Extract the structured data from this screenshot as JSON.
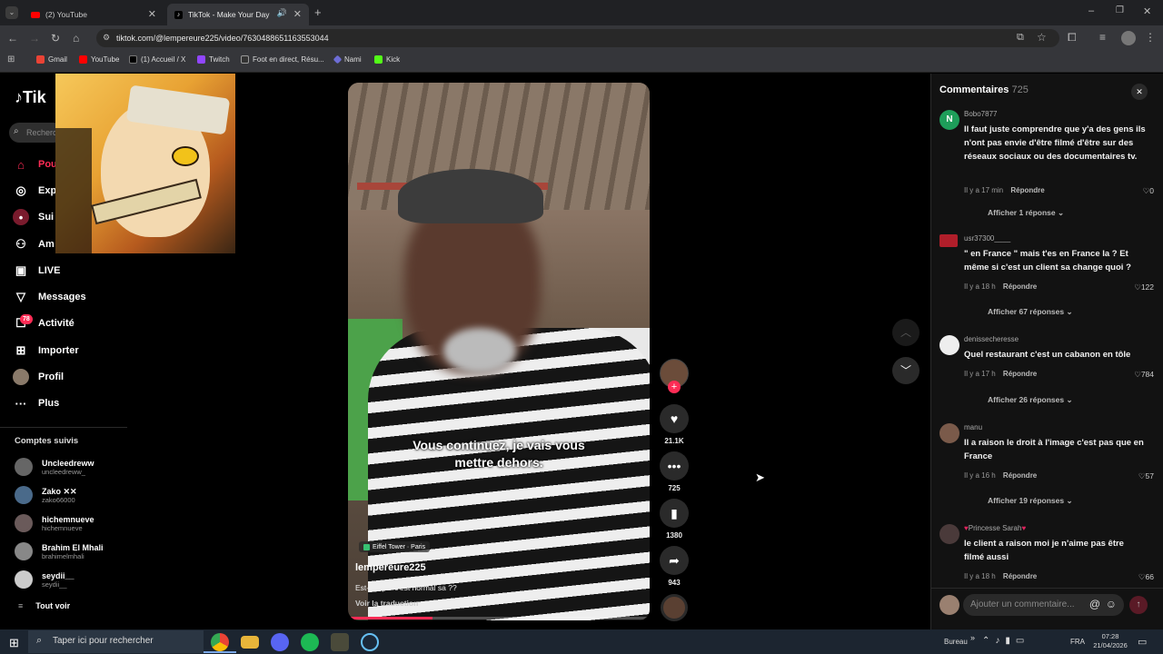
{
  "browser": {
    "tabs": [
      {
        "label": "(2) YouTube",
        "icon": "youtube-icon"
      },
      {
        "label": "TikTok - Make Your Day",
        "icon": "tiktok-icon"
      }
    ],
    "url": "tiktok.com/@lempereure225/video/7630488651163553044",
    "bookmarks": [
      "Gmail",
      "YouTube",
      "(1) Accueil / X",
      "Twitch",
      "Foot en direct, Résu...",
      "Nami",
      "Kick"
    ]
  },
  "sidebar": {
    "logo": "Tik",
    "search_placeholder": "Recherc",
    "items": [
      {
        "label": "Pou",
        "icon": "home-icon"
      },
      {
        "label": "Exp",
        "icon": "compass-icon"
      },
      {
        "label": "Sui",
        "icon": "following-icon"
      },
      {
        "label": "Am",
        "icon": "friends-icon"
      },
      {
        "label": "LIVE",
        "icon": "live-icon"
      },
      {
        "label": "Messages",
        "icon": "messages-icon"
      },
      {
        "label": "Activité",
        "icon": "activity-icon",
        "badge": "78"
      },
      {
        "label": "Importer",
        "icon": "upload-icon"
      },
      {
        "label": "Profil",
        "icon": "profile-icon"
      },
      {
        "label": "Plus",
        "icon": "more-icon"
      }
    ],
    "following_title": "Comptes suivis",
    "following": [
      {
        "name": "Uncleedreww",
        "handle": "uncleedreww_"
      },
      {
        "name": "Zako ✕✕",
        "handle": "zako66000"
      },
      {
        "name": "hichemnueve",
        "handle": "hichemnueve"
      },
      {
        "name": "Brahim El Mhali",
        "handle": "brahimelmhali"
      },
      {
        "name": "seydii__",
        "handle": "seydii__"
      }
    ],
    "see_all": "Tout voir"
  },
  "video": {
    "subtitle_line1": "Vous continuez, je vais vous",
    "subtitle_line2": "mettre dehors.",
    "location": "Eiffel Tower · Paris",
    "author": "lempereure225",
    "caption": "Est-ce que c'est normal sa ??",
    "translate": "Voir la traduction",
    "progress": 0.28
  },
  "actions": {
    "likes": "21.1K",
    "comments": "725",
    "saves": "1380",
    "shares": "943"
  },
  "comments_panel": {
    "title": "Commentaires",
    "count": "725",
    "items": [
      {
        "user": "Bobo7877",
        "avatar_letter": "N",
        "text": "Il faut juste comprendre que y'a des gens ils n'ont pas envie d'être filmé d'être sur des réseaux sociaux ou des documentaires tv.",
        "time": "Il y a 17 min",
        "reply": "Répondre",
        "likes": "0",
        "more": "Afficher 1 réponse"
      },
      {
        "user": "usr37300____",
        "text": "\" en France \" mais t'es en France la ? Et même si c'est un client sa change quoi ?",
        "time": "Il y a 18 h",
        "reply": "Répondre",
        "likes": "122",
        "more": "Afficher 67 réponses"
      },
      {
        "user": "denissecheresse",
        "text": "Quel restaurant c'est un cabanon en tôle",
        "time": "Il y a 17 h",
        "reply": "Répondre",
        "likes": "784",
        "more": "Afficher 26 réponses"
      },
      {
        "user": "manu",
        "text": "Il a raison le droit à l'image c'est pas que en France",
        "time": "Il y a 16 h",
        "reply": "Répondre",
        "likes": "57",
        "more": "Afficher 19 réponses"
      },
      {
        "user": "Princesse Sarah",
        "text": "le client a raison moi je n'aime pas être filmé aussi",
        "time": "Il y a 18 h",
        "reply": "Répondre",
        "likes": "66"
      }
    ],
    "input_placeholder": "Ajouter un commentaire..."
  },
  "taskbar": {
    "search_placeholder": "Taper ici pour rechercher",
    "desktop_label": "Bureau",
    "language": "FRA",
    "time": "07:28",
    "date": "21/04/2026"
  },
  "colors": {
    "accent": "#fe2c55",
    "panel": "#121212",
    "taskbar": "#1c2530"
  }
}
